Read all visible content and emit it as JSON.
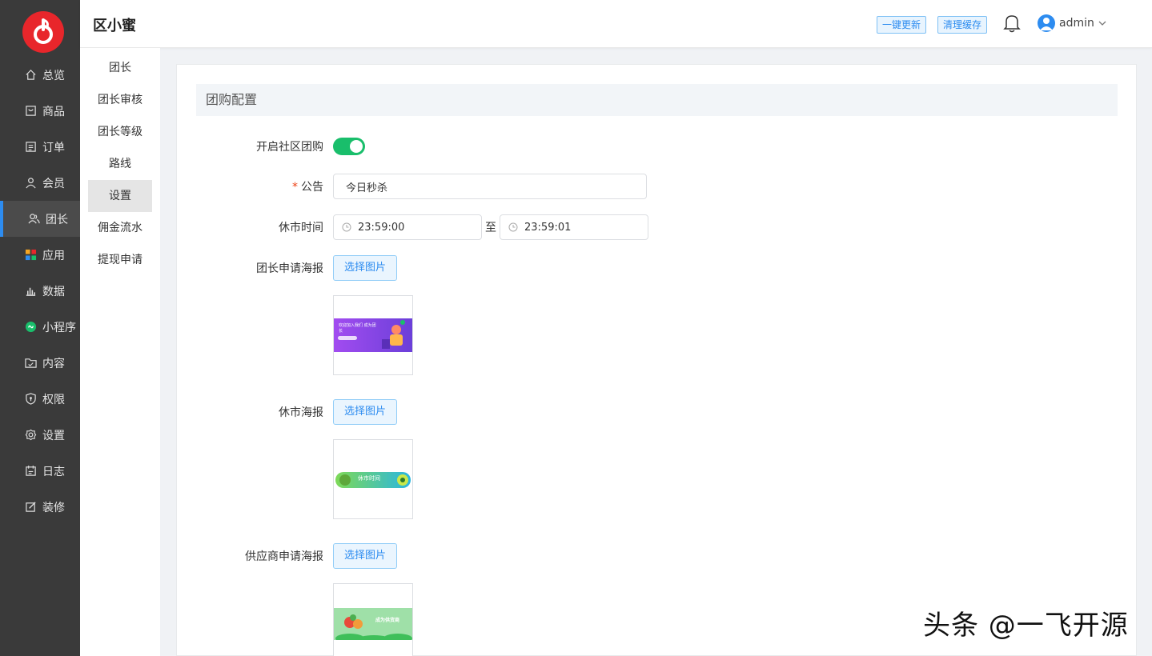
{
  "brand": "区小蜜",
  "header": {
    "update_label": "一键更新",
    "clear_cache_label": "清理缓存",
    "user_name": "admin"
  },
  "sidebar": {
    "items": [
      {
        "label": "总览",
        "icon": "home-icon"
      },
      {
        "label": "商品",
        "icon": "goods-icon"
      },
      {
        "label": "订单",
        "icon": "order-icon"
      },
      {
        "label": "会员",
        "icon": "member-icon"
      },
      {
        "label": "团长",
        "icon": "leader-icon",
        "active": true
      },
      {
        "label": "应用",
        "icon": "apps-icon"
      },
      {
        "label": "数据",
        "icon": "chart-icon"
      },
      {
        "label": "小程序",
        "icon": "miniprogram-icon"
      },
      {
        "label": "内容",
        "icon": "content-icon"
      },
      {
        "label": "权限",
        "icon": "permission-icon"
      },
      {
        "label": "设置",
        "icon": "settings-icon"
      },
      {
        "label": "日志",
        "icon": "log-icon"
      },
      {
        "label": "装修",
        "icon": "decorate-icon"
      }
    ]
  },
  "subnav": {
    "items": [
      {
        "label": "团长"
      },
      {
        "label": "团长审核"
      },
      {
        "label": "团长等级"
      },
      {
        "label": "路线"
      },
      {
        "label": "设置",
        "active": true
      },
      {
        "label": "佣金流水"
      },
      {
        "label": "提现申请"
      }
    ]
  },
  "form": {
    "section_title": "团购配置",
    "enable_label": "开启社区团购",
    "enable_value": true,
    "notice_label": "公告",
    "notice_value": "今日秒杀",
    "close_time_label": "休市时间",
    "close_time_start": "23:59:00",
    "close_time_to": "至",
    "close_time_end": "23:59:01",
    "leader_poster_label": "团长申请海报",
    "close_poster_label": "休市海报",
    "supplier_poster_label": "供应商申请海报",
    "pick_image_label": "选择图片"
  },
  "posters": {
    "leader_text": "欢迎加入我们 成为团长",
    "close_text": "休市时间",
    "supplier_text": "成为供货商"
  },
  "watermark": "头条 @一飞开源",
  "colors": {
    "sidebar_bg": "#3a3a3a",
    "accent": "#2d8cf0",
    "switch_on": "#19be6b",
    "logo_red": "#e8262b"
  }
}
